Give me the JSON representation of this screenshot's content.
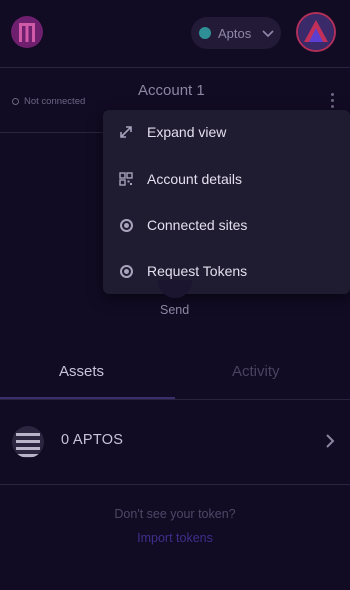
{
  "header": {
    "network_label": "Aptos",
    "network_dot_color": "#2f8f97",
    "logo_icon": "wallet-logo-icon",
    "avatar_icon": "account-avatar-icon"
  },
  "account": {
    "name": "Account 1",
    "connection_status": "Not connected"
  },
  "menu": {
    "items": [
      {
        "label": "Expand view",
        "icon": "expand-icon"
      },
      {
        "label": "Account details",
        "icon": "qr-icon"
      },
      {
        "label": "Connected sites",
        "icon": "radio-icon"
      },
      {
        "label": "Request Tokens",
        "icon": "radio-icon"
      }
    ]
  },
  "actions": {
    "send_label": "Send"
  },
  "tabs": [
    {
      "label": "Assets",
      "active": true
    },
    {
      "label": "Activity",
      "active": false
    }
  ],
  "assets": [
    {
      "amount_text": "0 APTOS",
      "icon": "aptos-token-icon"
    }
  ],
  "footer": {
    "hint": "Don't see your token?",
    "import_link": "Import tokens"
  },
  "colors": {
    "background": "#120b24",
    "menu_background": "#1f1b30",
    "accent": "#b0305a",
    "link": "#3e2f8a"
  }
}
